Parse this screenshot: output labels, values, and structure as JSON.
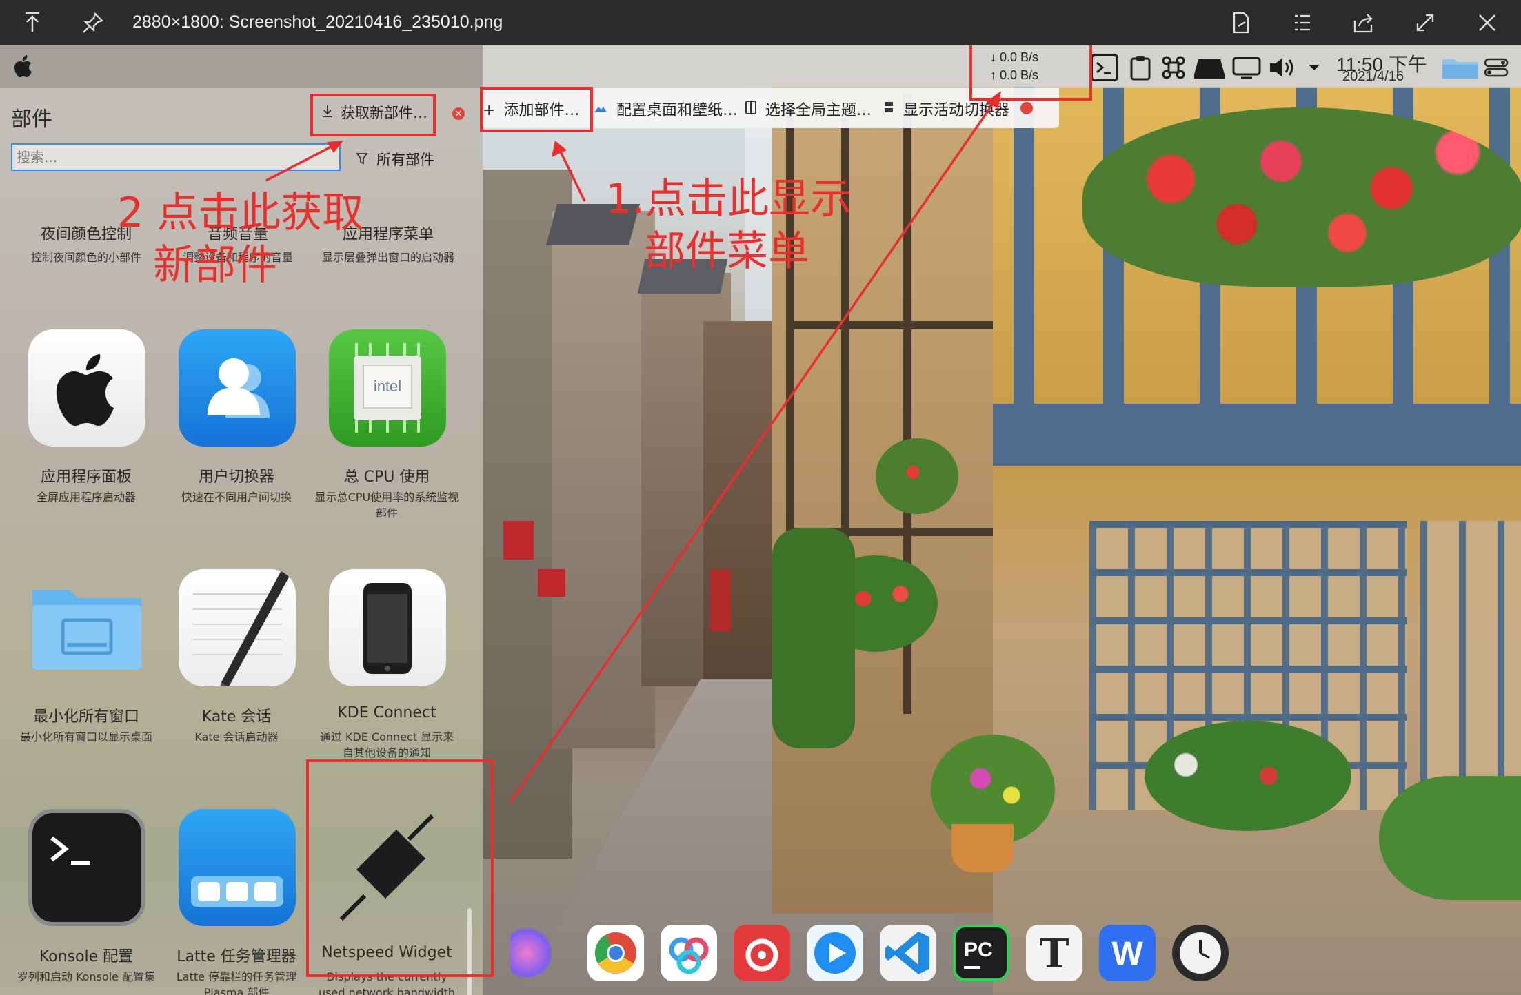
{
  "viewer": {
    "title": "2880×1800: Screenshot_20210416_235010.png",
    "left_icons": [
      "pin-top-icon",
      "pin-icon"
    ],
    "right_icons": [
      "export-file-icon",
      "list-icon",
      "share-icon",
      "fullscreen-icon",
      "close-icon"
    ]
  },
  "topbar": {
    "net_down": "↓  0.0 B/s",
    "net_up": "↑  0.0 B/s",
    "time": "11:50 下午",
    "date": "2021/4/16",
    "tray_icons": [
      "terminal-icon",
      "clipboard-icon",
      "command-icon",
      "drive-icon",
      "display-icon",
      "volume-icon",
      "chevron-down-icon",
      "folder-icon",
      "switch-icon"
    ]
  },
  "edit_toolbar": {
    "add_widgets": "添加部件…",
    "configure_desktop": "配置桌面和壁纸…",
    "global_theme": "选择全局主题…",
    "activity_switcher": "显示活动切换器"
  },
  "panel": {
    "title": "部件",
    "get_new": "获取新部件…",
    "search_placeholder": "搜索...",
    "filter": "所有部件",
    "top_row": [
      {
        "name": "夜间颜色控制",
        "desc": "控制夜间颜色的小部件"
      },
      {
        "name": "音频音量",
        "desc": "调整设备和程序的音量"
      },
      {
        "name": "应用程序菜单",
        "desc": "显示层叠弹出窗口的启动器"
      }
    ],
    "widgets": [
      {
        "name": "应用程序面板",
        "desc": "全屏应用程序启动器"
      },
      {
        "name": "用户切换器",
        "desc": "快速在不同用户间切换"
      },
      {
        "name": "总 CPU 使用",
        "desc": "显示总CPU使用率的系统监视部件"
      },
      {
        "name": "最小化所有窗口",
        "desc": "最小化所有窗口以显示桌面"
      },
      {
        "name": "Kate 会话",
        "desc": "Kate 会话启动器"
      },
      {
        "name": "KDE Connect",
        "desc": "通过 KDE Connect 显示来自其他设备的通知"
      },
      {
        "name": "Konsole 配置",
        "desc": "罗列和启动 Konsole 配置集"
      },
      {
        "name": "Latte 任务管理器",
        "desc": "Latte 停靠栏的任务管理 Plasma 部件"
      },
      {
        "name": "Netspeed Widget",
        "desc": "Displays the currently used network bandwidth"
      }
    ]
  },
  "annotations": {
    "step1_line1": "1.点击此显示",
    "step1_line2": "部件菜单",
    "step2_line1": "2 点击此获取",
    "step2_line2": "新部件"
  },
  "dock": {
    "apps": [
      "kite-icon",
      "chrome-icon",
      "baidu-netdisk-icon",
      "netease-music-icon",
      "video-player-icon",
      "vscode-icon",
      "pycharm-icon",
      "typora-icon",
      "wps-icon",
      "clock-icon"
    ]
  },
  "colors": {
    "annotation_red": "#e8312e",
    "search_border": "#3a8fd8"
  }
}
